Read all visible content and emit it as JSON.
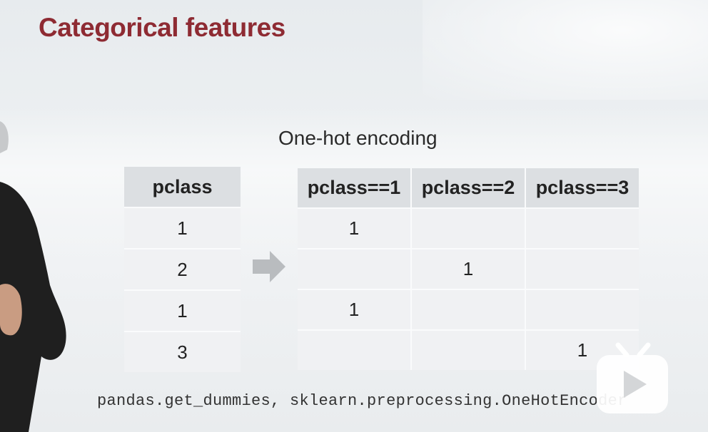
{
  "slide": {
    "title": "Categorical features",
    "subtitle": "One-hot encoding"
  },
  "left_table": {
    "header": "pclass",
    "rows": [
      "1",
      "2",
      "1",
      "3"
    ]
  },
  "right_table": {
    "headers": [
      "pclass==1",
      "pclass==2",
      "pclass==3"
    ],
    "rows": [
      [
        "1",
        "",
        ""
      ],
      [
        "",
        "1",
        ""
      ],
      [
        "1",
        "",
        ""
      ],
      [
        "",
        "",
        "1"
      ]
    ]
  },
  "code_line": "pandas.get_dummies, sklearn.preprocessing.OneHotEncoder",
  "icons": {
    "arrow": "right-arrow-icon",
    "play": "play-icon"
  },
  "colors": {
    "title": "#8e2b33",
    "header_bg": "#dcdfe2",
    "cell_bg": "#f0f1f3"
  }
}
